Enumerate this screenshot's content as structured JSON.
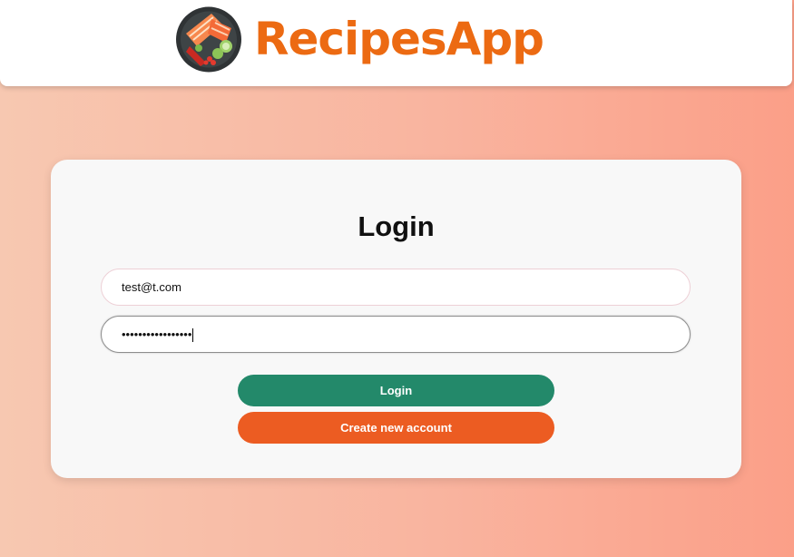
{
  "header": {
    "brand": "RecipesApp",
    "logo_icon": "sushi-bowl-icon"
  },
  "login_card": {
    "title": "Login",
    "email_value": "test@t.com",
    "password_masked": "•••••••••••••••••",
    "login_button": "Login",
    "create_account_button": "Create new account"
  },
  "colors": {
    "brand": "#ec6a12",
    "login_button": "#23896a",
    "create_button": "#ec5c22"
  }
}
